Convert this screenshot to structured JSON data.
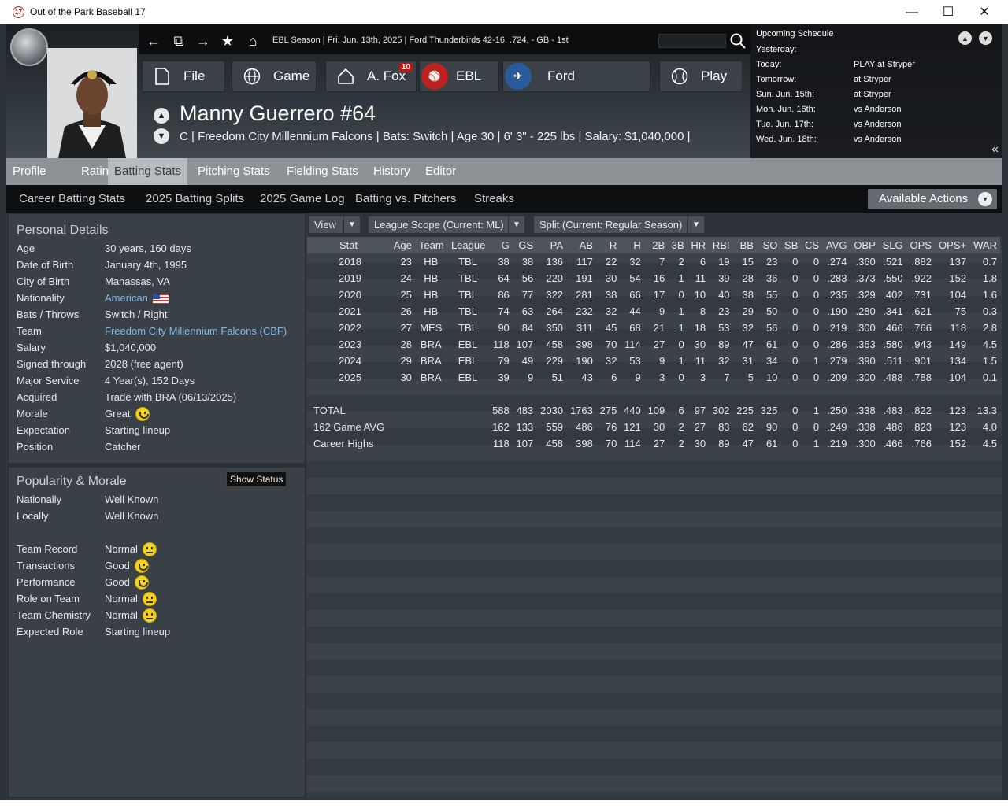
{
  "window": {
    "title": "Out of the Park Baseball 17",
    "icon_text": "17",
    "minimize": "—",
    "maximize": "☐",
    "close": "✕"
  },
  "nav": {
    "season_info": "EBL Season  |  Fri. Jun. 13th, 2025  |  Ford Thunderbirds   42-16, .724, - GB - 1st",
    "buttons": [
      {
        "label": "File",
        "icon": "file-icon"
      },
      {
        "label": "Game",
        "icon": "globe-icon"
      },
      {
        "label": "A. Fox",
        "icon": "home-icon",
        "badge": "10"
      },
      {
        "label": "EBL",
        "icon": "ebl-logo-icon"
      },
      {
        "label": "Ford",
        "icon": "ford-logo-icon"
      },
      {
        "label": "Play",
        "icon": "baseball-icon"
      }
    ]
  },
  "player": {
    "name": "Manny Guerrero  #64",
    "info": "C | Freedom City Millennium Falcons  |  Bats: Switch  |  Age 30  |  6' 3\" - 225 lbs  |  Salary: $1,040,000  |"
  },
  "schedule": {
    "title": "Upcoming Schedule",
    "rows": [
      {
        "day": "Yesterday:",
        "event": ""
      },
      {
        "day": "Today:",
        "event": "PLAY at Stryper"
      },
      {
        "day": "Tomorrow:",
        "event": "at Stryper"
      },
      {
        "day": "Sun. Jun. 15th:",
        "event": "at Stryper"
      },
      {
        "day": "Mon. Jun. 16th:",
        "event": "vs Anderson"
      },
      {
        "day": "Tue. Jun. 17th:",
        "event": "vs Anderson"
      },
      {
        "day": "Wed. Jun. 18th:",
        "event": "vs Anderson"
      }
    ]
  },
  "tabs": [
    "Profile",
    "Ratings",
    "Batting Stats",
    "Pitching Stats",
    "Fielding Stats",
    "History",
    "Editor"
  ],
  "active_tab": "Batting Stats",
  "subtabs": [
    "Career Batting Stats",
    "2025 Batting Splits",
    "2025 Game Log",
    "Batting vs. Pitchers",
    "Streaks"
  ],
  "available_actions": "Available Actions",
  "personal": {
    "title": "Personal Details",
    "rows": [
      {
        "k": "Age",
        "v": "30 years, 160 days"
      },
      {
        "k": "Date of Birth",
        "v": "January 4th, 1995"
      },
      {
        "k": "City of Birth",
        "v": "Manassas, VA"
      },
      {
        "k": "Nationality",
        "v": "American"
      },
      {
        "k": "Bats / Throws",
        "v": "Switch / Right"
      },
      {
        "k": "Team",
        "v": "Freedom City Millennium Falcons (CBF)"
      },
      {
        "k": "Salary",
        "v": "$1,040,000"
      },
      {
        "k": "Signed through",
        "v": "2028 (free agent)"
      },
      {
        "k": "Major Service",
        "v": "4 Year(s), 152 Days"
      },
      {
        "k": "Acquired",
        "v": "Trade with BRA (06/13/2025)"
      },
      {
        "k": "Morale",
        "v": "Great"
      },
      {
        "k": "Expectation",
        "v": "Starting lineup"
      },
      {
        "k": "Position",
        "v": "Catcher"
      }
    ]
  },
  "popularity": {
    "title": "Popularity & Morale",
    "show_status": "Show Status",
    "rows": [
      {
        "k": "Nationally",
        "v": "Well Known"
      },
      {
        "k": "Locally",
        "v": "Well Known"
      },
      {
        "k": "Team Record",
        "v": "Normal",
        "mood": "neutral"
      },
      {
        "k": "Transactions",
        "v": "Good",
        "mood": "happy"
      },
      {
        "k": "Performance",
        "v": "Good",
        "mood": "happy"
      },
      {
        "k": "Role on Team",
        "v": "Normal",
        "mood": "neutral"
      },
      {
        "k": "Team Chemistry",
        "v": "Normal",
        "mood": "neutral"
      },
      {
        "k": "Expected Role",
        "v": "Starting lineup"
      }
    ]
  },
  "filters": {
    "view": "View",
    "scope": "League Scope  (Current: ML)",
    "split": "Split  (Current: Regular Season)"
  },
  "stats": {
    "headers": [
      "Stat",
      "Age",
      "Team",
      "League",
      "G",
      "GS",
      "PA",
      "AB",
      "R",
      "H",
      "2B",
      "3B",
      "HR",
      "RBI",
      "BB",
      "SO",
      "SB",
      "CS",
      "AVG",
      "OBP",
      "SLG",
      "OPS",
      "OPS+",
      "WAR"
    ],
    "rows": [
      [
        "2018",
        "23",
        "HB",
        "TBL",
        "38",
        "38",
        "136",
        "117",
        "22",
        "32",
        "7",
        "2",
        "6",
        "19",
        "15",
        "23",
        "0",
        "0",
        ".274",
        ".360",
        ".521",
        ".882",
        "137",
        "0.7"
      ],
      [
        "2019",
        "24",
        "HB",
        "TBL",
        "64",
        "56",
        "220",
        "191",
        "30",
        "54",
        "16",
        "1",
        "11",
        "39",
        "28",
        "36",
        "0",
        "0",
        ".283",
        ".373",
        ".550",
        ".922",
        "152",
        "1.8"
      ],
      [
        "2020",
        "25",
        "HB",
        "TBL",
        "86",
        "77",
        "322",
        "281",
        "38",
        "66",
        "17",
        "0",
        "10",
        "40",
        "38",
        "55",
        "0",
        "0",
        ".235",
        ".329",
        ".402",
        ".731",
        "104",
        "1.6"
      ],
      [
        "2021",
        "26",
        "HB",
        "TBL",
        "74",
        "63",
        "264",
        "232",
        "32",
        "44",
        "9",
        "1",
        "8",
        "23",
        "29",
        "50",
        "0",
        "0",
        ".190",
        ".280",
        ".341",
        ".621",
        "75",
        "0.3"
      ],
      [
        "2022",
        "27",
        "MES",
        "TBL",
        "90",
        "84",
        "350",
        "311",
        "45",
        "68",
        "21",
        "1",
        "18",
        "53",
        "32",
        "56",
        "0",
        "0",
        ".219",
        ".300",
        ".466",
        ".766",
        "118",
        "2.8"
      ],
      [
        "2023",
        "28",
        "BRA",
        "EBL",
        "118",
        "107",
        "458",
        "398",
        "70",
        "114",
        "27",
        "0",
        "30",
        "89",
        "47",
        "61",
        "0",
        "0",
        ".286",
        ".363",
        ".580",
        ".943",
        "149",
        "4.5"
      ],
      [
        "2024",
        "29",
        "BRA",
        "EBL",
        "79",
        "49",
        "229",
        "190",
        "32",
        "53",
        "9",
        "1",
        "11",
        "32",
        "31",
        "34",
        "0",
        "1",
        ".279",
        ".390",
        ".511",
        ".901",
        "134",
        "1.5"
      ],
      [
        "2025",
        "30",
        "BRA",
        "EBL",
        "39",
        "9",
        "51",
        "43",
        "6",
        "9",
        "3",
        "0",
        "3",
        "7",
        "5",
        "10",
        "0",
        "0",
        ".209",
        ".300",
        ".488",
        ".788",
        "104",
        "0.1"
      ],
      [
        "",
        "",
        "",
        "",
        "",
        "",
        "",
        "",
        "",
        "",
        "",
        "",
        "",
        "",
        "",
        "",
        "",
        "",
        "",
        "",
        "",
        "",
        "",
        ""
      ],
      [
        "TOTAL",
        "",
        "",
        "",
        "588",
        "483",
        "2030",
        "1763",
        "275",
        "440",
        "109",
        "6",
        "97",
        "302",
        "225",
        "325",
        "0",
        "1",
        ".250",
        ".338",
        ".483",
        ".822",
        "123",
        "13.3"
      ],
      [
        "162 Game AVG",
        "",
        "",
        "",
        "162",
        "133",
        "559",
        "486",
        "76",
        "121",
        "30",
        "2",
        "27",
        "83",
        "62",
        "90",
        "0",
        "0",
        ".249",
        ".338",
        ".486",
        ".823",
        "123",
        "4.0"
      ],
      [
        "Career Highs",
        "",
        "",
        "",
        "118",
        "107",
        "458",
        "398",
        "70",
        "114",
        "27",
        "2",
        "30",
        "89",
        "47",
        "61",
        "0",
        "1",
        ".219",
        ".300",
        ".466",
        ".766",
        "152",
        "4.5"
      ]
    ]
  }
}
